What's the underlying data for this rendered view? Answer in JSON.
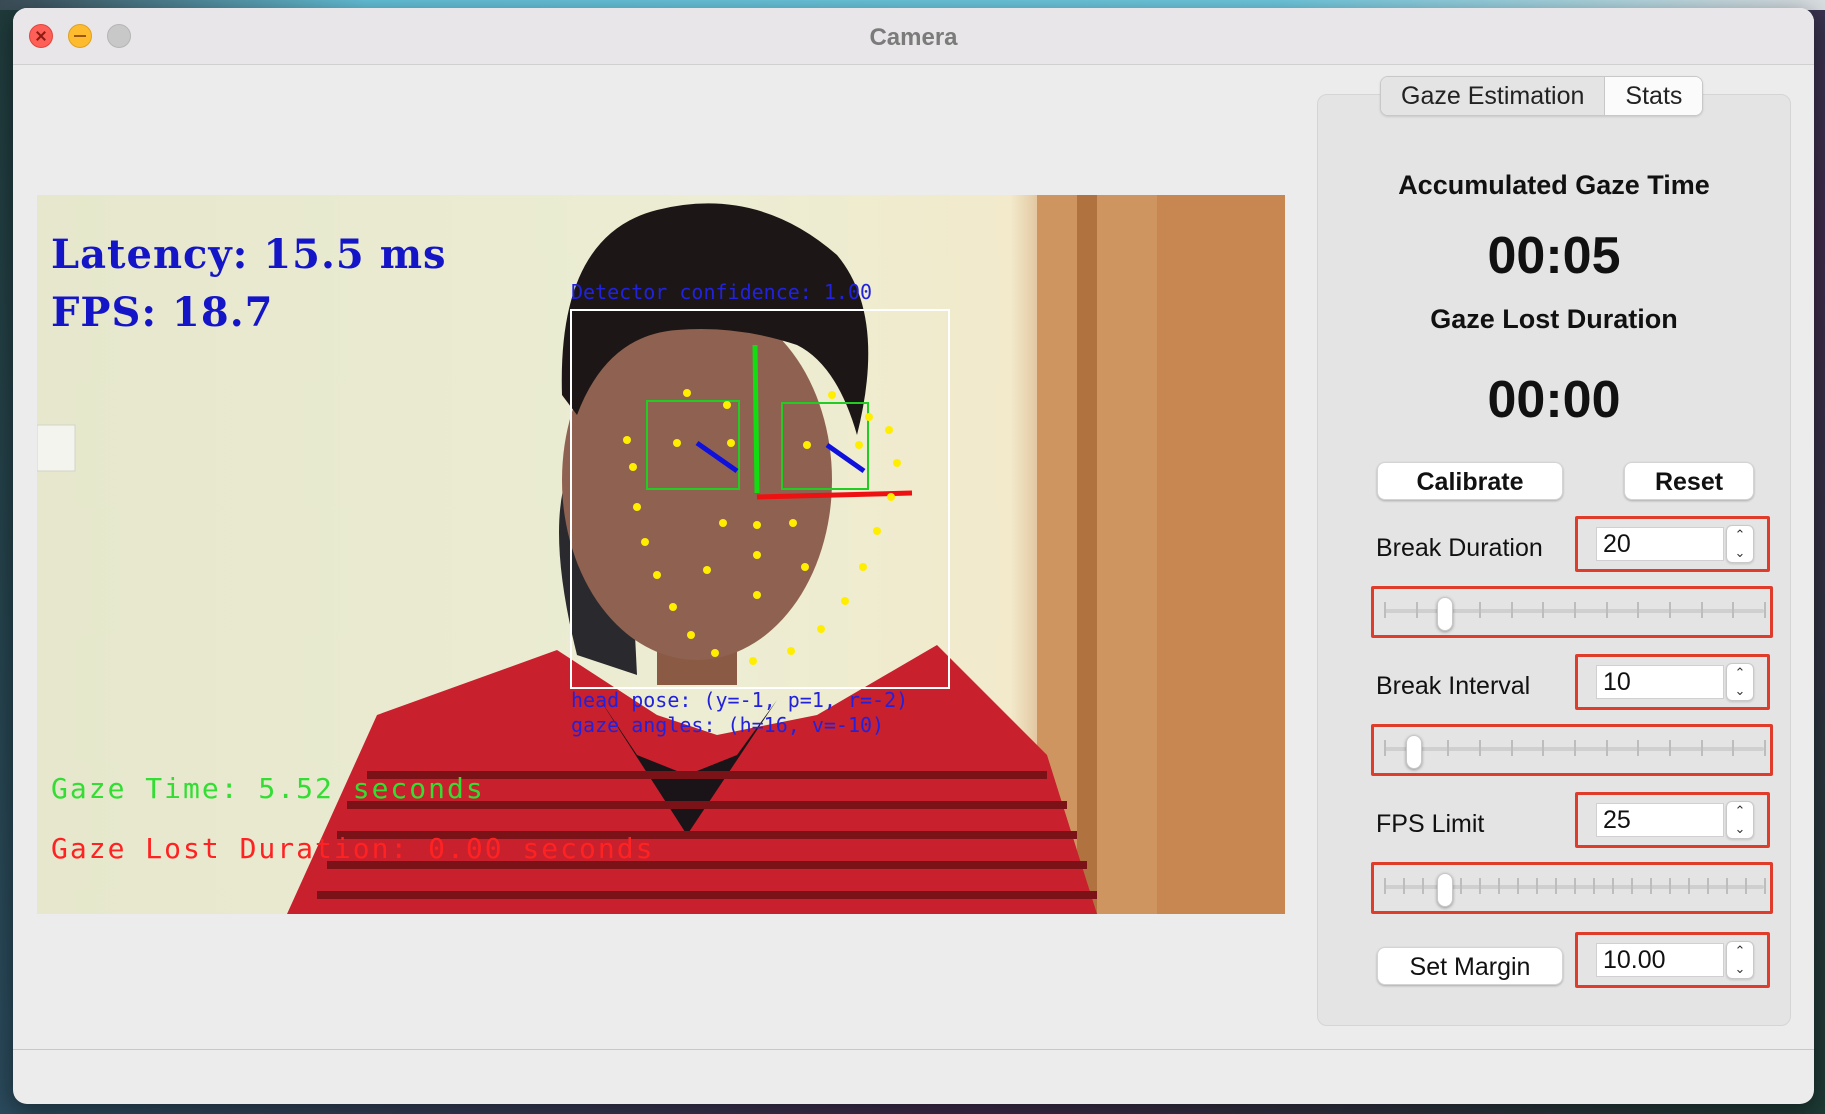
{
  "window": {
    "title": "Camera"
  },
  "video": {
    "latency": "Latency: 15.5 ms",
    "fps": "FPS: 18.7",
    "detector_confidence": "Detector confidence: 1.00",
    "head_pose": "head pose: (y=-1, p=1, r=-2)",
    "gaze_angles": "gaze angles: (h=16, v=-10)",
    "gaze_time": "Gaze Time: 5.52 seconds",
    "gaze_lost": "Gaze Lost Duration: 0.00 seconds"
  },
  "tabs": [
    {
      "label": "Gaze Estimation",
      "active": true
    },
    {
      "label": "Stats",
      "active": false
    }
  ],
  "stats": {
    "accumulated_label": "Accumulated Gaze Time",
    "accumulated_value": "00:05",
    "lost_label": "Gaze Lost Duration",
    "lost_value": "00:00"
  },
  "buttons": {
    "calibrate": "Calibrate",
    "reset": "Reset",
    "set_margin": "Set Margin"
  },
  "settings": {
    "break_duration": {
      "label": "Break Duration",
      "value": "20",
      "slider_fraction": 0.16
    },
    "break_interval": {
      "label": "Break Interval",
      "value": "10",
      "slider_fraction": 0.08
    },
    "fps_limit": {
      "label": "FPS Limit",
      "value": "25",
      "slider_fraction": 0.16
    },
    "margin": {
      "value": "10.00"
    }
  },
  "colors": {
    "highlight": "#e03c2c",
    "overlay_blue": "#2222dd",
    "overlay_green": "#33dd33",
    "overlay_red": "#ff2222"
  },
  "icons": {
    "close": "close-icon",
    "minimize": "minimize-icon",
    "maximize": "maximize-icon",
    "spin_up": "chevron-up-icon",
    "spin_down": "chevron-down-icon"
  }
}
